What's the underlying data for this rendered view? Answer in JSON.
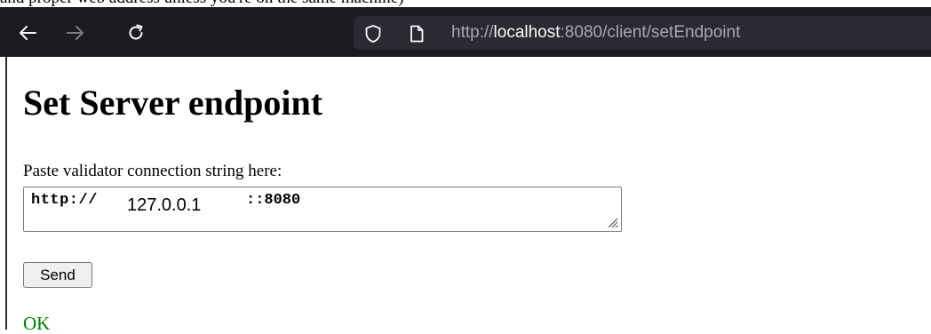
{
  "top_text": "and proper web address unless you're on the same machine)",
  "browser": {
    "url_scheme": "http://",
    "url_host": "localhost",
    "url_rest": ":8080/client/setEndpoint"
  },
  "page": {
    "heading": "Set Server endpoint",
    "field_label": "Paste validator connection string here:",
    "textarea": {
      "prefix": "http://",
      "ip": "127.0.0.1",
      "suffix": "::8080"
    },
    "send_label": "Send",
    "status_text": "OK"
  },
  "colors": {
    "toolbar_bg": "#1c1b22",
    "urlbar_bg": "#2b2a33",
    "status_green": "#008000"
  }
}
